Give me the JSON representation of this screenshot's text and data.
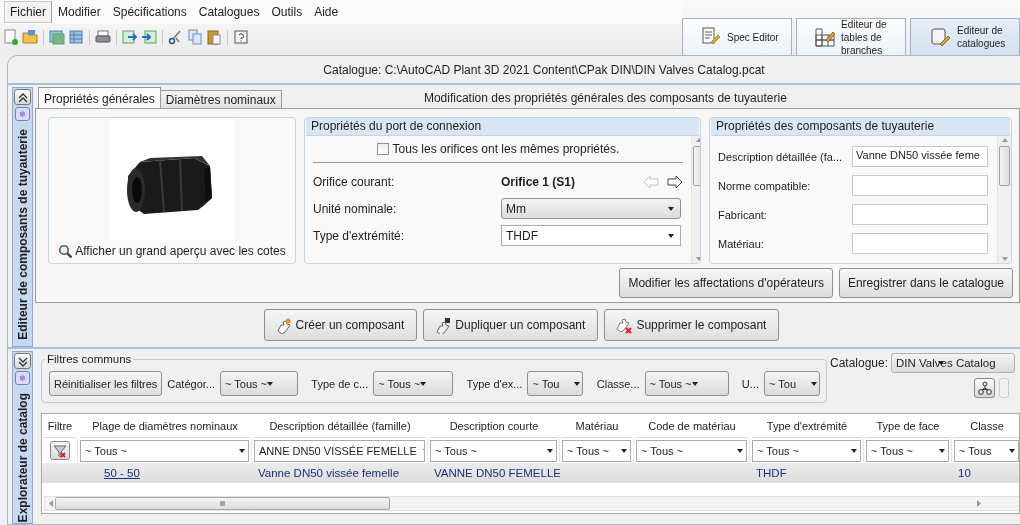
{
  "menu": [
    {
      "label": "Fichier",
      "selected": true
    },
    {
      "label": "Modifier",
      "selected": false
    },
    {
      "label": "Spécifications",
      "selected": false
    },
    {
      "label": "Catalogues",
      "selected": false
    },
    {
      "label": "Outils",
      "selected": false
    },
    {
      "label": "Aide",
      "selected": false
    }
  ],
  "mode_tabs": [
    {
      "label": "Spec Editor",
      "kind": "spec",
      "selected": false
    },
    {
      "label": "Editeur de tables de branches",
      "kind": "branch",
      "selected": false
    },
    {
      "label": "Editeur de catalogues",
      "kind": "catalog",
      "selected": true
    }
  ],
  "catalog_path": "Catalogue: C:\\AutoCAD Plant 3D 2021 Content\\CPak DIN\\DIN Valves Catalog.pcat",
  "editor": {
    "side_label": "Editeur de composants de tuyauterie",
    "expanded": true,
    "tabs": [
      {
        "label": "Propriétés générales",
        "selected": true
      },
      {
        "label": "Diamètres nominaux",
        "selected": false
      }
    ],
    "heading": "Modification des propriétés générales des composants de tuyauterie",
    "preview": {
      "kind": "picture",
      "link": "Afficher un grand aperçu avec les cotes"
    },
    "port": {
      "title": "Propriétés du port de connexion",
      "same_props": {
        "label": "Tous les orifices ont les mêmes propriétés.",
        "checked": false
      },
      "rows": [
        {
          "kind": "value",
          "label": "Orifice courant:",
          "value": "Orifice 1 (S1)",
          "previous_enabled": false,
          "next_enabled": true
        },
        {
          "kind": "select",
          "label": "Unité nominale:",
          "value": "Mm"
        },
        {
          "kind": "dropdown",
          "label": "Type d'extrémité:",
          "value": "THDF"
        }
      ]
    },
    "component": {
      "title": "Propriétés des composants de tuyauterie",
      "fields": [
        {
          "label": "Description détaillée (fa...",
          "value": "Vanne DN50 vissée feme"
        },
        {
          "label": "Norme compatible:"
        },
        {
          "label": "Fabricant:"
        },
        {
          "label": "Matériau:"
        }
      ]
    },
    "buttons": [
      "Modifier les affectations d'opérateurs",
      "Enregistrer dans le catalogue"
    ],
    "actions": [
      {
        "label": "Créer un composant",
        "kind": "create"
      },
      {
        "label": "Dupliquer un composant",
        "kind": "duplicate"
      },
      {
        "label": "Supprimer le composant",
        "kind": "delete"
      }
    ]
  },
  "explorer": {
    "side_label": "Explorateur de catalog",
    "expanded": false,
    "filters": {
      "title": "Filtres communs",
      "reset": "Réinitialiser les filtres",
      "items": [
        {
          "label": "Catégor...",
          "value": "~ Tous ~"
        },
        {
          "label": "Type de c...",
          "value": "~ Tous ~"
        },
        {
          "label": "Type d'ex...",
          "value": "~ Tou"
        },
        {
          "label": "Classe...",
          "value": "~ Tous ~"
        },
        {
          "label": "U...",
          "value": "~ Tou"
        }
      ]
    },
    "catalog": {
      "label": "Catalogue:",
      "value": "DIN Valves Catalog"
    },
    "table": {
      "columns": [
        "Filtre",
        "Plage de diamètres nominaux",
        "Description détaillée (famille)",
        "Description courte",
        "Matériau",
        "Code de matériau",
        "Type d'extrémité",
        "Type de face",
        "Classe"
      ],
      "filters": [
        "~ Tous ~",
        "ANNE DN50 VISSÉE FEMELLE",
        "~ Tous ~",
        "~ Tous ~",
        "~ Tous ~",
        "~ Tous ~",
        "~ Tous ~",
        "~ Tous"
      ],
      "rows": [
        {
          "selected": true,
          "cells": [
            "",
            "50 - 50",
            "Vanne DN50 vissée femelle",
            "VANNE DN50 FEMELLE",
            "",
            "",
            "THDF",
            "",
            "10"
          ]
        }
      ]
    }
  }
}
